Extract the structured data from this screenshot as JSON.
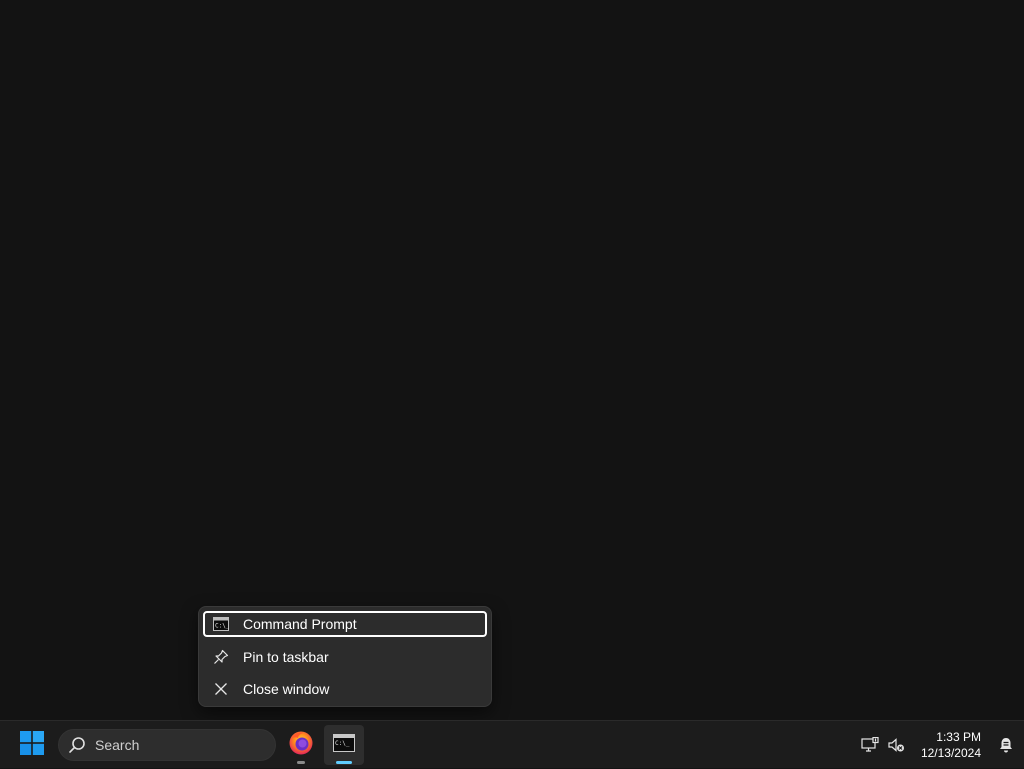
{
  "jumplist": {
    "items": [
      {
        "label": "Command Prompt",
        "icon": "cmd-icon",
        "focused": true
      },
      {
        "label": "Pin to taskbar",
        "icon": "pin-icon",
        "focused": false
      },
      {
        "label": "Close window",
        "icon": "close-icon",
        "focused": false
      }
    ]
  },
  "taskbar": {
    "search_placeholder": "Search",
    "apps": [
      {
        "name": "Firefox",
        "icon": "firefox-icon",
        "active": false,
        "running": true
      },
      {
        "name": "Command Prompt",
        "icon": "cmd-icon",
        "active": true,
        "running": true
      }
    ],
    "tray": {
      "icons": [
        "network-icon",
        "volume-muted-icon",
        "notifications-icon"
      ],
      "time": "1:33 PM",
      "date": "12/13/2024"
    }
  },
  "colors": {
    "accent": "#60cdff",
    "taskbar_bg": "#1c1c1c",
    "menu_bg": "#2c2c2c",
    "desktop_bg": "#131313",
    "start_blue": "#1e9bf0"
  }
}
